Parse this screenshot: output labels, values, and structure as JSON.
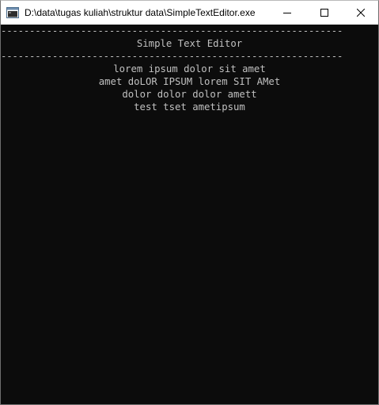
{
  "window": {
    "title": "D:\\data\\tugas kuliah\\struktur data\\SimpleTextEditor.exe",
    "icon": "console-app-icon",
    "controls": {
      "minimize_icon": "minimize-icon",
      "maximize_icon": "maximize-icon",
      "close_icon": "close-icon"
    }
  },
  "console": {
    "separator_top": "------------------------------------------------------------",
    "header": "Simple Text Editor",
    "separator_bottom": "------------------------------------------------------------",
    "lines": [
      "lorem ipsum dolor sit amet",
      "amet doLOR IPSUM lorem SIT AMet",
      "dolor dolor dolor amett",
      "test tset ametipsum"
    ],
    "colors": {
      "background": "#0c0c0c",
      "text": "#c0c0c0"
    }
  }
}
